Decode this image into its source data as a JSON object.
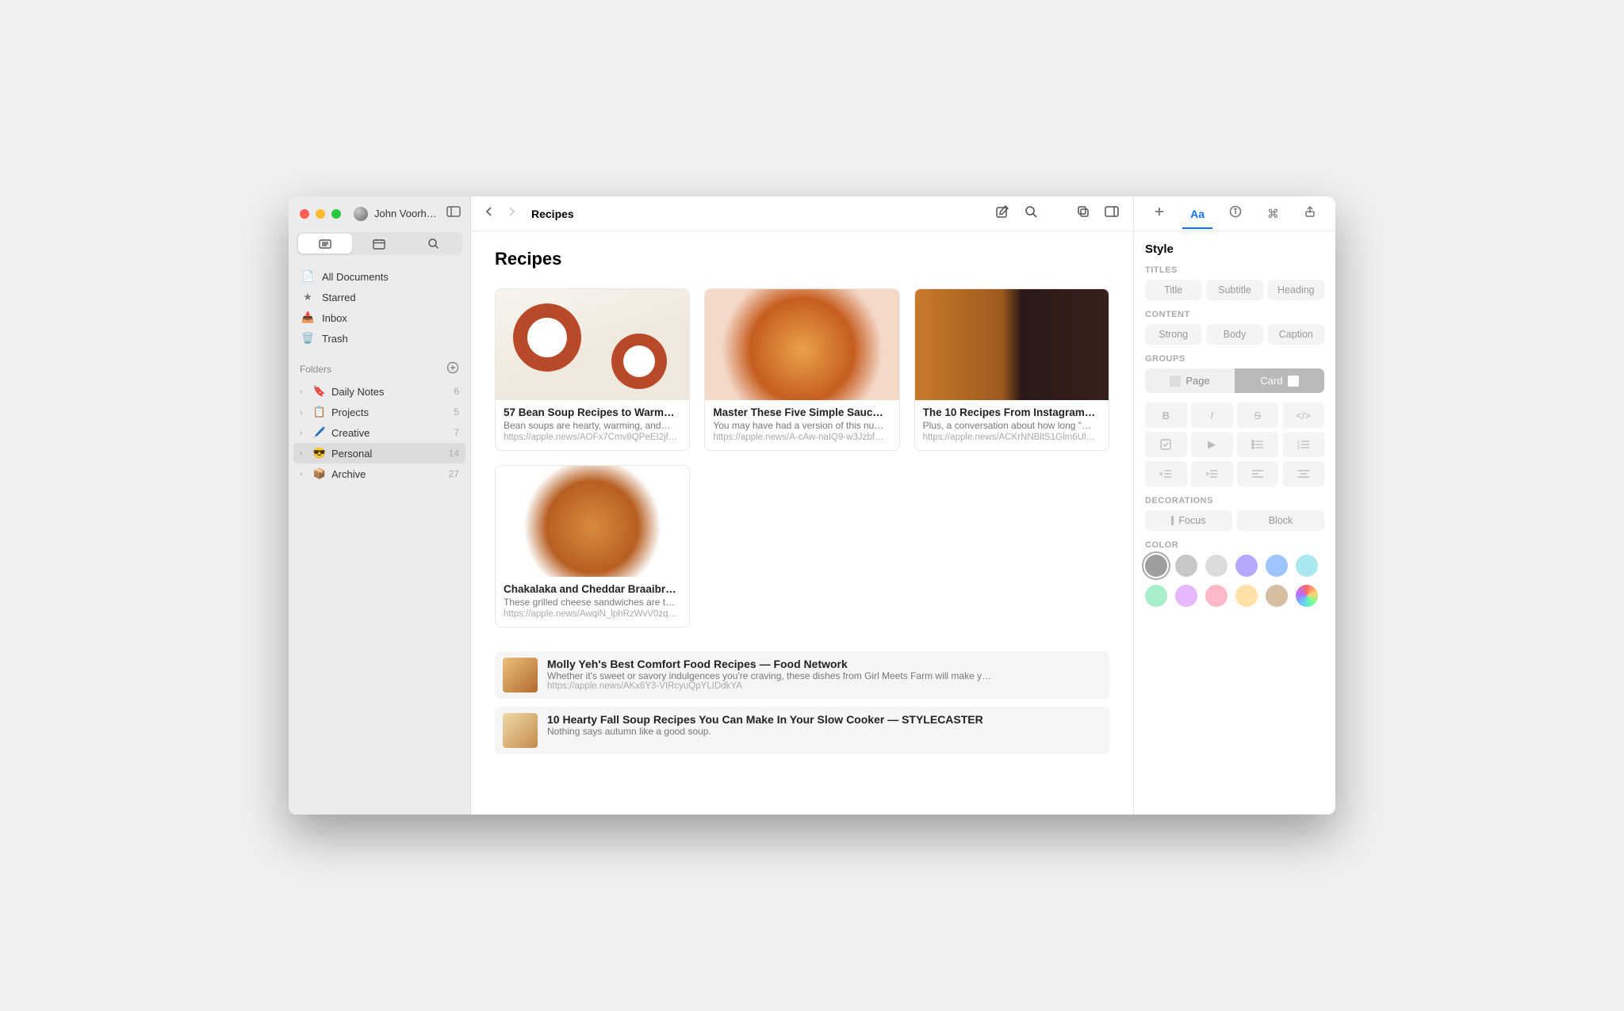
{
  "user": {
    "name": "John Voorhe…"
  },
  "sidebar": {
    "nav": [
      {
        "label": "All Documents",
        "icon": "document-icon"
      },
      {
        "label": "Starred",
        "icon": "star-icon"
      },
      {
        "label": "Inbox",
        "icon": "inbox-icon"
      },
      {
        "label": "Trash",
        "icon": "trash-icon"
      }
    ],
    "section_label": "Folders",
    "folders": [
      {
        "emoji": "🔖",
        "label": "Daily Notes",
        "count": "6"
      },
      {
        "emoji": "📋",
        "label": "Projects",
        "count": "5"
      },
      {
        "emoji": "🖊️",
        "label": "Creative",
        "count": "7"
      },
      {
        "emoji": "😎",
        "label": "Personal",
        "count": "14",
        "selected": true
      },
      {
        "emoji": "📦",
        "label": "Archive",
        "count": "27"
      }
    ]
  },
  "toolbar": {
    "title": "Recipes"
  },
  "page": {
    "title": "Recipes",
    "cards": [
      {
        "title": "57 Bean Soup Recipes to Warm…",
        "desc": "Bean soups are hearty, warming, and…",
        "url": "https://apple.news/AOFx7Cmv8QPeEI2jfH…"
      },
      {
        "title": "Master These Five Simple Sauc…",
        "desc": "You may have had a version of this nu…",
        "url": "https://apple.news/A-cAw-naIQ9-w3Jzbf…"
      },
      {
        "title": "The 10 Recipes From Instagram…",
        "desc": "Plus, a conversation about how long \"…",
        "url": "https://apple.news/ACKrNNBltS1Glm6UlY…"
      },
      {
        "title": "Chakalaka and Cheddar Braaibr…",
        "desc": "These grilled cheese sandwiches are t…",
        "url": "https://apple.news/AwqiN_lphRzWvV0zqx…"
      }
    ],
    "list": [
      {
        "title": "Molly Yeh's Best Comfort Food Recipes — Food Network",
        "desc": "Whether it's sweet or savory indulgences you're craving, these dishes from Girl Meets Farm will make y…",
        "url": "https://apple.news/AKx6Y3-VIRcyuQpYLIDdkYA"
      },
      {
        "title": "10 Hearty Fall Soup Recipes You Can Make In Your Slow Cooker — STYLECASTER",
        "desc": "Nothing says autumn like a good soup.",
        "url": ""
      }
    ]
  },
  "inspector": {
    "heading": "Style",
    "titles_label": "Titles",
    "titles": [
      "Title",
      "Subtitle",
      "Heading"
    ],
    "content_label": "Content",
    "content": [
      "Strong",
      "Body",
      "Caption"
    ],
    "groups_label": "Groups",
    "groups": {
      "page": "Page",
      "card": "Card"
    },
    "decorations_label": "Decorations",
    "decorations": {
      "focus": "Focus",
      "block": "Block"
    },
    "color_label": "Color",
    "colors": [
      "#9e9e9e",
      "#c7c7c7",
      "#dcdcdc",
      "#b7a8ff",
      "#9ec5ff",
      "#a8e8ee",
      "#a8eec8",
      "#e5b8ff",
      "#ffb8c6",
      "#ffe0a8",
      "#d6bfa0"
    ]
  }
}
